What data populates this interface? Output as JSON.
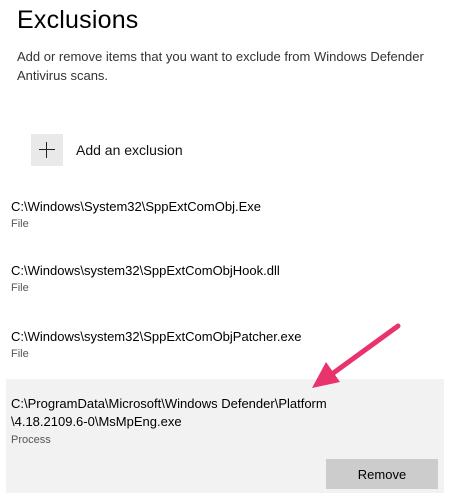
{
  "page": {
    "title": "Exclusions",
    "description_line1": "Add or remove items that you want to exclude from Windows Defender",
    "description_line2": "Antivirus scans."
  },
  "add_exclusion": {
    "label": "Add an exclusion",
    "icon": "plus-icon"
  },
  "exclusions": [
    {
      "path": "C:\\Windows\\System32\\SppExtComObj.Exe",
      "type": "File"
    },
    {
      "path": "C:\\Windows\\system32\\SppExtComObjHook.dll",
      "type": "File"
    },
    {
      "path": "C:\\Windows\\system32\\SppExtComObjPatcher.exe",
      "type": "File"
    },
    {
      "path_line1": "C:\\ProgramData\\Microsoft\\Windows Defender\\Platform",
      "path_line2": "\\4.18.2109.6-0\\MsMpEng.exe",
      "type": "Process",
      "selected": true
    }
  ],
  "actions": {
    "remove_label": "Remove"
  },
  "annotation": {
    "arrow_color": "#e8336d"
  }
}
